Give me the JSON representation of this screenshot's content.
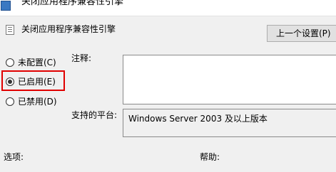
{
  "window": {
    "title": "关闭应用程序兼容性引擎"
  },
  "policy": {
    "name": "关闭应用程序兼容性引擎",
    "prev_setting_button": "上一个设置(P)"
  },
  "state_options": [
    {
      "label": "未配置(C)",
      "selected": false
    },
    {
      "label": "已启用(E)",
      "selected": true
    },
    {
      "label": "已禁用(D)",
      "selected": false
    }
  ],
  "fields": {
    "comment_label": "注释:",
    "comment_value": "",
    "supported_on_label": "支持的平台:",
    "supported_on_value": "Windows Server 2003 及以上版本"
  },
  "sections": {
    "options_label": "选项:",
    "help_label": "帮助:"
  },
  "colors": {
    "highlight": "#e00000",
    "window_bg": "#f0f0f0"
  }
}
